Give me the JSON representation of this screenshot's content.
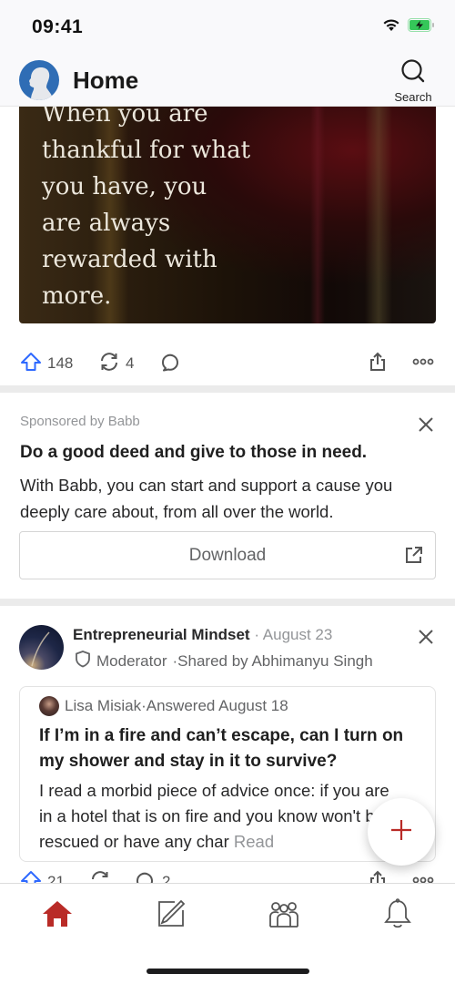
{
  "status_bar": {
    "time": "09:41",
    "wifi_icon": "wifi-icon",
    "battery_icon": "battery-charging-icon",
    "battery_color": "#35c759"
  },
  "header": {
    "title": "Home",
    "logo_icon": "profile-avatar-icon",
    "search_label": "Search",
    "search_icon": "search-icon"
  },
  "feed": {
    "post1": {
      "quote_text": "When you are\nthankful for what\nyou have, you\nare always\nrewarded with\nmore.",
      "actions": {
        "upvotes": "148",
        "shares": "4",
        "comments": ""
      }
    },
    "ad": {
      "sponsor": "Sponsored by Babb",
      "title": "Do a good deed and give to those in need.",
      "body": "With Babb, you can start and support a cause you deeply care about, from all over the world.",
      "cta_label": "Download"
    },
    "post2": {
      "space_name": "Entrepreneurial Mindset",
      "separator": " · ",
      "date": "August 23",
      "role": "Moderator",
      "shared_by": "Shared by Abhimanyu Singh",
      "answerer_name": "Lisa Misiak",
      "answered": "Answered August 18",
      "question": "If I’m in a fire and can’t escape, can I turn on my shower and stay in it to survive?",
      "answer_preview": "I read a morbid piece of advice once: if you are in a hotel that is on fire and you know won't be rescued or have any char",
      "read_more": "Read",
      "actions": {
        "upvotes": "21",
        "shares": "",
        "comments": "2"
      }
    }
  },
  "fab": {
    "icon": "plus-icon",
    "color": "#b92b27"
  },
  "tabs": [
    {
      "name": "home",
      "active": true
    },
    {
      "name": "write"
    },
    {
      "name": "spaces"
    },
    {
      "name": "notifications"
    }
  ],
  "colors": {
    "accent": "#b92b27",
    "upvote": "#2e69ff"
  }
}
